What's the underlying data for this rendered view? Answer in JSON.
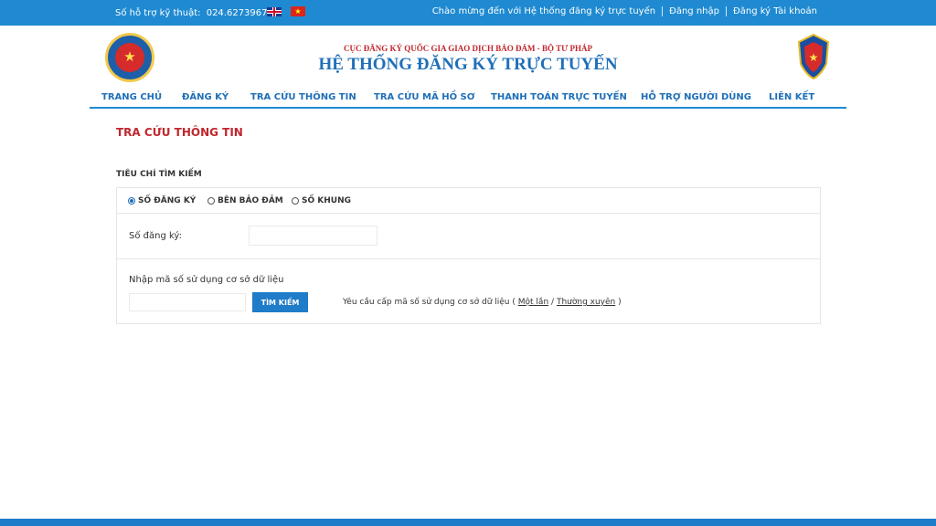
{
  "topbar": {
    "support_label": "Số hỗ trợ kỹ thuật:",
    "support_number": "024.62739677",
    "welcome": "Chào mừng đến với Hệ thống đăng ký trực tuyến",
    "login": "Đăng nhập",
    "register": "Đăng ký Tài khoản"
  },
  "header": {
    "subtitle": "CỤC ĐĂNG KÝ QUỐC GIA GIAO DỊCH BẢO ĐẢM - BỘ TƯ PHÁP",
    "title": "HỆ THỐNG ĐĂNG KÝ TRỰC TUYẾN"
  },
  "nav": {
    "items": [
      {
        "label": "TRANG CHỦ"
      },
      {
        "label": "ĐĂNG KÝ"
      },
      {
        "label": "TRA CỨU THÔNG TIN"
      },
      {
        "label": "TRA CỨU MÃ HỒ SƠ"
      },
      {
        "label": "THANH TOÁN TRỰC TUYẾN"
      },
      {
        "label": "HỖ TRỢ NGƯỜI DÙNG"
      },
      {
        "label": "LIÊN KẾT"
      }
    ]
  },
  "main": {
    "page_title": "TRA CỨU THÔNG TIN",
    "criteria_label": "TIÊU CHÍ TÌM KIẾM",
    "radios": [
      {
        "label": "SỐ ĐĂNG KÝ",
        "checked": true
      },
      {
        "label": "BÊN BẢO ĐẢM",
        "checked": false
      },
      {
        "label": "SỐ KHUNG",
        "checked": false
      }
    ],
    "reg_number_label": "Số đăng ký:",
    "reg_number_value": "",
    "db_code_label": "Nhập mã số sử dụng cơ sở dữ liệu",
    "db_code_value": "",
    "search_button": "TÌM KIẾM",
    "request_text": "Yêu cầu cấp mã số sử dụng cơ sở dữ liệu (",
    "once_link": "Một lần",
    "slash": "/",
    "regular_link": "Thường xuyên",
    "close_paren": ")"
  },
  "colors": {
    "brand_blue": "#1f8ad1",
    "title_blue": "#1f6fb8",
    "accent_red": "#c0272d"
  },
  "icons": {
    "en_flag": "uk-flag-icon",
    "vn_flag": "vietnam-flag-icon",
    "left_logo": "ministry-emblem-icon",
    "right_logo": "police-emblem-icon"
  }
}
